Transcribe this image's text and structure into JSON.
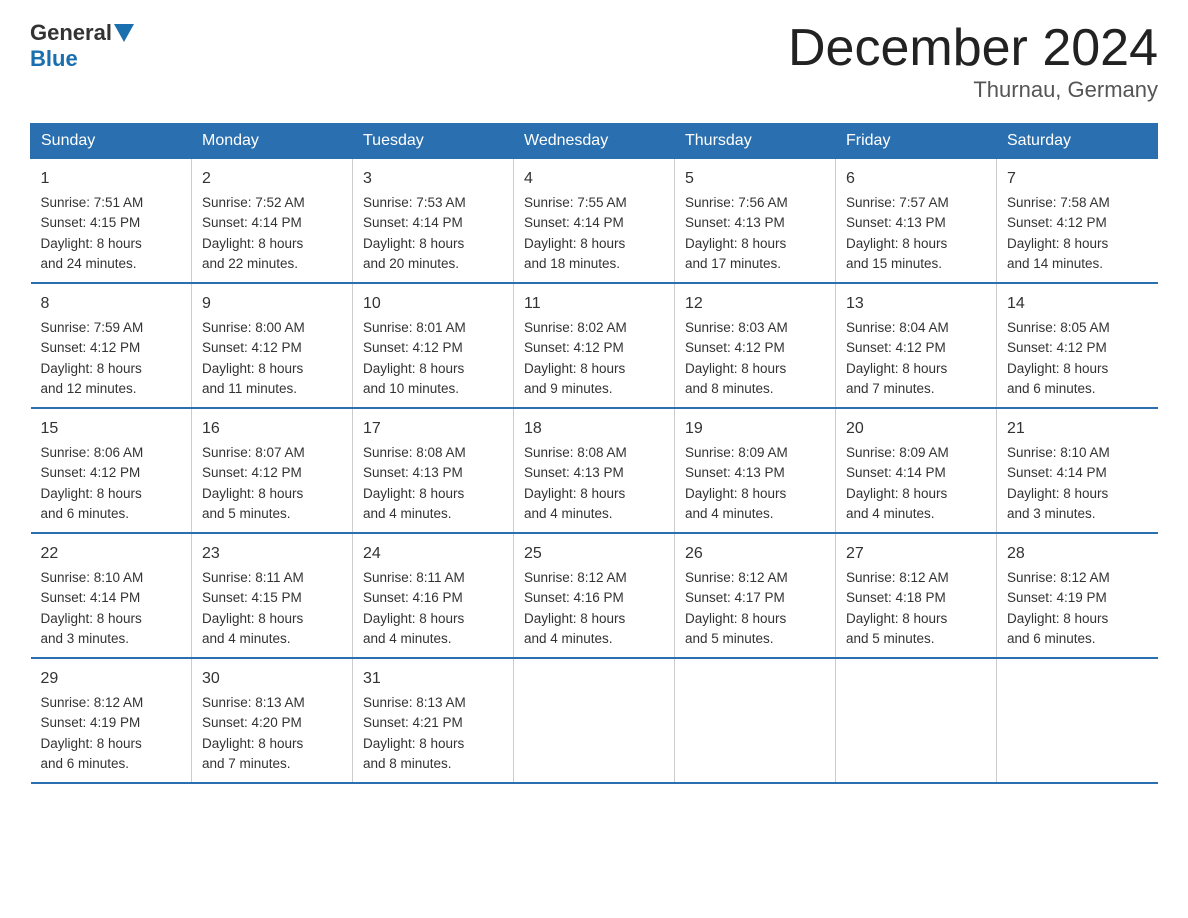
{
  "header": {
    "logo_text1": "General",
    "logo_text2": "Blue",
    "month_title": "December 2024",
    "location": "Thurnau, Germany"
  },
  "days_of_week": [
    "Sunday",
    "Monday",
    "Tuesday",
    "Wednesday",
    "Thursday",
    "Friday",
    "Saturday"
  ],
  "weeks": [
    [
      {
        "day": "1",
        "sunrise": "7:51 AM",
        "sunset": "4:15 PM",
        "daylight": "8 hours and 24 minutes."
      },
      {
        "day": "2",
        "sunrise": "7:52 AM",
        "sunset": "4:14 PM",
        "daylight": "8 hours and 22 minutes."
      },
      {
        "day": "3",
        "sunrise": "7:53 AM",
        "sunset": "4:14 PM",
        "daylight": "8 hours and 20 minutes."
      },
      {
        "day": "4",
        "sunrise": "7:55 AM",
        "sunset": "4:14 PM",
        "daylight": "8 hours and 18 minutes."
      },
      {
        "day": "5",
        "sunrise": "7:56 AM",
        "sunset": "4:13 PM",
        "daylight": "8 hours and 17 minutes."
      },
      {
        "day": "6",
        "sunrise": "7:57 AM",
        "sunset": "4:13 PM",
        "daylight": "8 hours and 15 minutes."
      },
      {
        "day": "7",
        "sunrise": "7:58 AM",
        "sunset": "4:12 PM",
        "daylight": "8 hours and 14 minutes."
      }
    ],
    [
      {
        "day": "8",
        "sunrise": "7:59 AM",
        "sunset": "4:12 PM",
        "daylight": "8 hours and 12 minutes."
      },
      {
        "day": "9",
        "sunrise": "8:00 AM",
        "sunset": "4:12 PM",
        "daylight": "8 hours and 11 minutes."
      },
      {
        "day": "10",
        "sunrise": "8:01 AM",
        "sunset": "4:12 PM",
        "daylight": "8 hours and 10 minutes."
      },
      {
        "day": "11",
        "sunrise": "8:02 AM",
        "sunset": "4:12 PM",
        "daylight": "8 hours and 9 minutes."
      },
      {
        "day": "12",
        "sunrise": "8:03 AM",
        "sunset": "4:12 PM",
        "daylight": "8 hours and 8 minutes."
      },
      {
        "day": "13",
        "sunrise": "8:04 AM",
        "sunset": "4:12 PM",
        "daylight": "8 hours and 7 minutes."
      },
      {
        "day": "14",
        "sunrise": "8:05 AM",
        "sunset": "4:12 PM",
        "daylight": "8 hours and 6 minutes."
      }
    ],
    [
      {
        "day": "15",
        "sunrise": "8:06 AM",
        "sunset": "4:12 PM",
        "daylight": "8 hours and 6 minutes."
      },
      {
        "day": "16",
        "sunrise": "8:07 AM",
        "sunset": "4:12 PM",
        "daylight": "8 hours and 5 minutes."
      },
      {
        "day": "17",
        "sunrise": "8:08 AM",
        "sunset": "4:13 PM",
        "daylight": "8 hours and 4 minutes."
      },
      {
        "day": "18",
        "sunrise": "8:08 AM",
        "sunset": "4:13 PM",
        "daylight": "8 hours and 4 minutes."
      },
      {
        "day": "19",
        "sunrise": "8:09 AM",
        "sunset": "4:13 PM",
        "daylight": "8 hours and 4 minutes."
      },
      {
        "day": "20",
        "sunrise": "8:09 AM",
        "sunset": "4:14 PM",
        "daylight": "8 hours and 4 minutes."
      },
      {
        "day": "21",
        "sunrise": "8:10 AM",
        "sunset": "4:14 PM",
        "daylight": "8 hours and 3 minutes."
      }
    ],
    [
      {
        "day": "22",
        "sunrise": "8:10 AM",
        "sunset": "4:14 PM",
        "daylight": "8 hours and 3 minutes."
      },
      {
        "day": "23",
        "sunrise": "8:11 AM",
        "sunset": "4:15 PM",
        "daylight": "8 hours and 4 minutes."
      },
      {
        "day": "24",
        "sunrise": "8:11 AM",
        "sunset": "4:16 PM",
        "daylight": "8 hours and 4 minutes."
      },
      {
        "day": "25",
        "sunrise": "8:12 AM",
        "sunset": "4:16 PM",
        "daylight": "8 hours and 4 minutes."
      },
      {
        "day": "26",
        "sunrise": "8:12 AM",
        "sunset": "4:17 PM",
        "daylight": "8 hours and 5 minutes."
      },
      {
        "day": "27",
        "sunrise": "8:12 AM",
        "sunset": "4:18 PM",
        "daylight": "8 hours and 5 minutes."
      },
      {
        "day": "28",
        "sunrise": "8:12 AM",
        "sunset": "4:19 PM",
        "daylight": "8 hours and 6 minutes."
      }
    ],
    [
      {
        "day": "29",
        "sunrise": "8:12 AM",
        "sunset": "4:19 PM",
        "daylight": "8 hours and 6 minutes."
      },
      {
        "day": "30",
        "sunrise": "8:13 AM",
        "sunset": "4:20 PM",
        "daylight": "8 hours and 7 minutes."
      },
      {
        "day": "31",
        "sunrise": "8:13 AM",
        "sunset": "4:21 PM",
        "daylight": "8 hours and 8 minutes."
      },
      null,
      null,
      null,
      null
    ]
  ],
  "labels": {
    "sunrise": "Sunrise: ",
    "sunset": "Sunset: ",
    "daylight": "Daylight: "
  }
}
